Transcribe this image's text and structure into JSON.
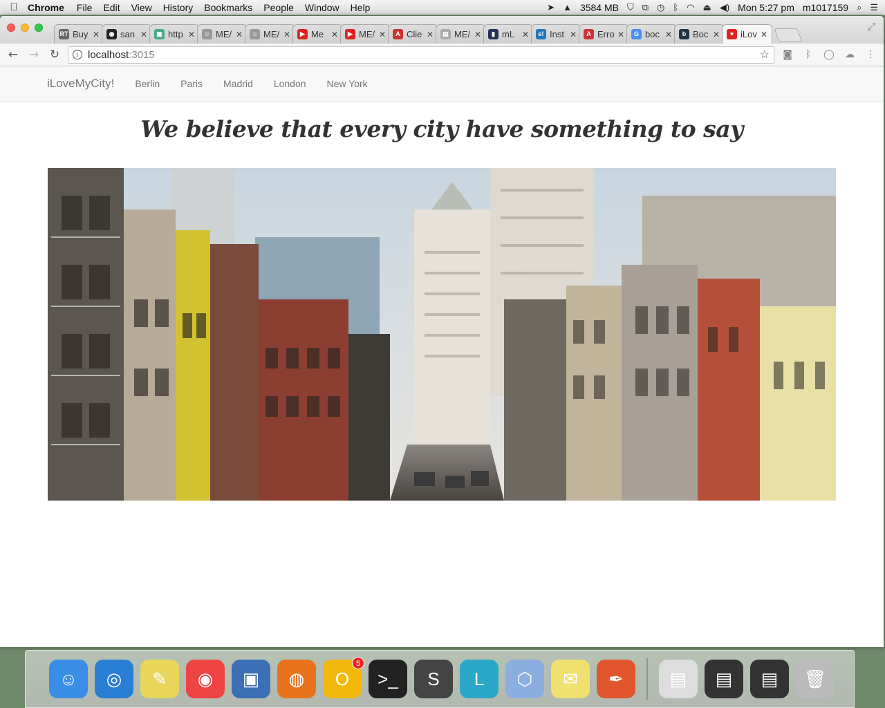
{
  "menubar": {
    "app": "Chrome",
    "menus": [
      "File",
      "Edit",
      "View",
      "History",
      "Bookmarks",
      "People",
      "Window",
      "Help"
    ],
    "memory": "3584 MB",
    "clock": "Mon 5:27 pm",
    "user": "m1017159"
  },
  "tabs": [
    {
      "title": "Buy",
      "color": "#666",
      "glyph": "RT"
    },
    {
      "title": "san",
      "color": "#222",
      "glyph": "◉"
    },
    {
      "title": "http",
      "color": "#4a8",
      "glyph": "▣"
    },
    {
      "title": "ME/",
      "color": "#999",
      "glyph": "☺"
    },
    {
      "title": "ME/",
      "color": "#999",
      "glyph": "☺"
    },
    {
      "title": "Me",
      "color": "#d22",
      "glyph": "▶"
    },
    {
      "title": "ME/",
      "color": "#d22",
      "glyph": "▶"
    },
    {
      "title": "Clie",
      "color": "#c33",
      "glyph": "A"
    },
    {
      "title": "ME/",
      "color": "#aaa",
      "glyph": "▤"
    },
    {
      "title": "mL",
      "color": "#235",
      "glyph": "▮"
    },
    {
      "title": "Inst",
      "color": "#27b",
      "glyph": "e!"
    },
    {
      "title": "Erro",
      "color": "#c33",
      "glyph": "A"
    },
    {
      "title": "boc",
      "color": "#4a8ff0",
      "glyph": "G"
    },
    {
      "title": "Boc",
      "color": "#234",
      "glyph": "b"
    },
    {
      "title": "iLov",
      "color": "#d22",
      "glyph": "♥"
    }
  ],
  "toolbar": {
    "host": "localhost",
    "port": ":3015"
  },
  "site": {
    "brand": "iLoveMyCity!",
    "nav": [
      "Berlin",
      "Paris",
      "Madrid",
      "London",
      "New York"
    ],
    "headline": "We believe that every city have something to say"
  },
  "dock": [
    {
      "name": "finder",
      "color": "#3a8ee6",
      "glyph": "☺"
    },
    {
      "name": "safari",
      "color": "#2a7fd4",
      "glyph": "◎"
    },
    {
      "name": "stickies",
      "color": "#e8d65a",
      "glyph": "✎"
    },
    {
      "name": "chrome",
      "color": "#e44",
      "glyph": "◉"
    },
    {
      "name": "virtualbox",
      "color": "#3c6fb4",
      "glyph": "▣"
    },
    {
      "name": "firefox",
      "color": "#e8731c",
      "glyph": "◍"
    },
    {
      "name": "opera",
      "color": "#f2b90c",
      "glyph": "O",
      "badge": "5"
    },
    {
      "name": "terminal",
      "color": "#222",
      "glyph": ">_"
    },
    {
      "name": "sublime",
      "color": "#444",
      "glyph": "S"
    },
    {
      "name": "launcher",
      "color": "#2ba8c8",
      "glyph": "L"
    },
    {
      "name": "cube-app",
      "color": "#8aaee0",
      "glyph": "⬡"
    },
    {
      "name": "notes",
      "color": "#f0e070",
      "glyph": "✉"
    },
    {
      "name": "paw",
      "color": "#e0552c",
      "glyph": "✒"
    },
    {
      "name": "window-1",
      "color": "#ddd",
      "glyph": "▤"
    },
    {
      "name": "window-2",
      "color": "#333",
      "glyph": "▤"
    },
    {
      "name": "window-3",
      "color": "#333",
      "glyph": "▤"
    },
    {
      "name": "trash",
      "color": "#bbb",
      "glyph": "🗑"
    }
  ]
}
